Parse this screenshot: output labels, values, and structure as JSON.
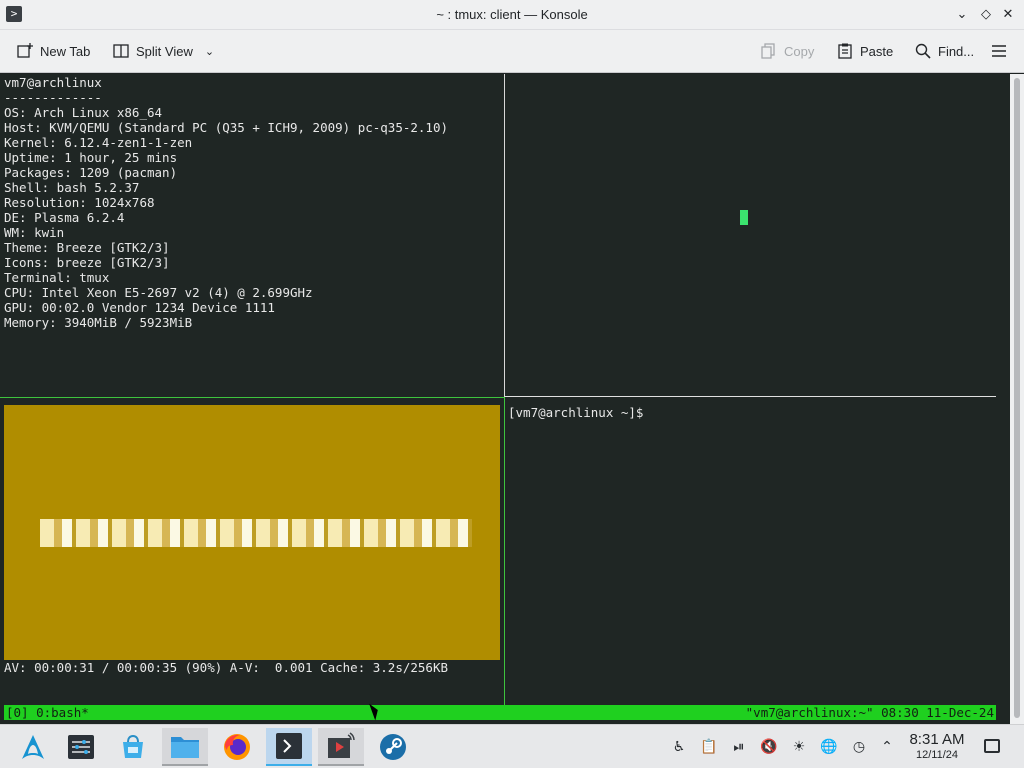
{
  "window": {
    "title": "~ : tmux: client — Konsole"
  },
  "toolbar": {
    "new_tab": "New Tab",
    "split_view": "Split View",
    "copy": "Copy",
    "paste": "Paste",
    "find": "Find..."
  },
  "terminal": {
    "neofetch": [
      "vm7@archlinux",
      "-------------",
      "OS: Arch Linux x86_64",
      "Host: KVM/QEMU (Standard PC (Q35 + ICH9, 2009) pc-q35-2.10)",
      "Kernel: 6.12.4-zen1-1-zen",
      "Uptime: 1 hour, 25 mins",
      "Packages: 1209 (pacman)",
      "Shell: bash 5.2.37",
      "Resolution: 1024x768",
      "DE: Plasma 6.2.4",
      "WM: kwin",
      "Theme: Breeze [GTK2/3]",
      "Icons: breeze [GTK2/3]",
      "Terminal: tmux",
      "CPU: Intel Xeon E5-2697 v2 (4) @ 2.699GHz",
      "GPU: 00:02.0 Vendor 1234 Device 1111",
      "Memory: 3940MiB / 5923MiB"
    ],
    "prompt": "[vm7@archlinux ~]$",
    "player_status": "AV: 00:00:31 / 00:00:35 (90%) A-V:  0.001 Cache: 3.2s/256KB",
    "tmux_left": "[0] 0:bash*",
    "tmux_right": "\"vm7@archlinux:~\" 08:30 11-Dec-24"
  },
  "taskbar": {
    "time": "8:31 AM",
    "date": "12/11/24",
    "apps": [
      "application-launcher-icon",
      "system-settings-icon",
      "discover-icon",
      "file-manager-icon",
      "firefox-icon",
      "konsole-icon",
      "video-player-icon",
      "steam-icon"
    ]
  },
  "colors": {
    "terminal_bg": "#1f2624",
    "tmux_status": "#1fd01f",
    "video_bg": "#b08d00",
    "cursor": "#3be36e",
    "active_task": "#3daee9"
  }
}
